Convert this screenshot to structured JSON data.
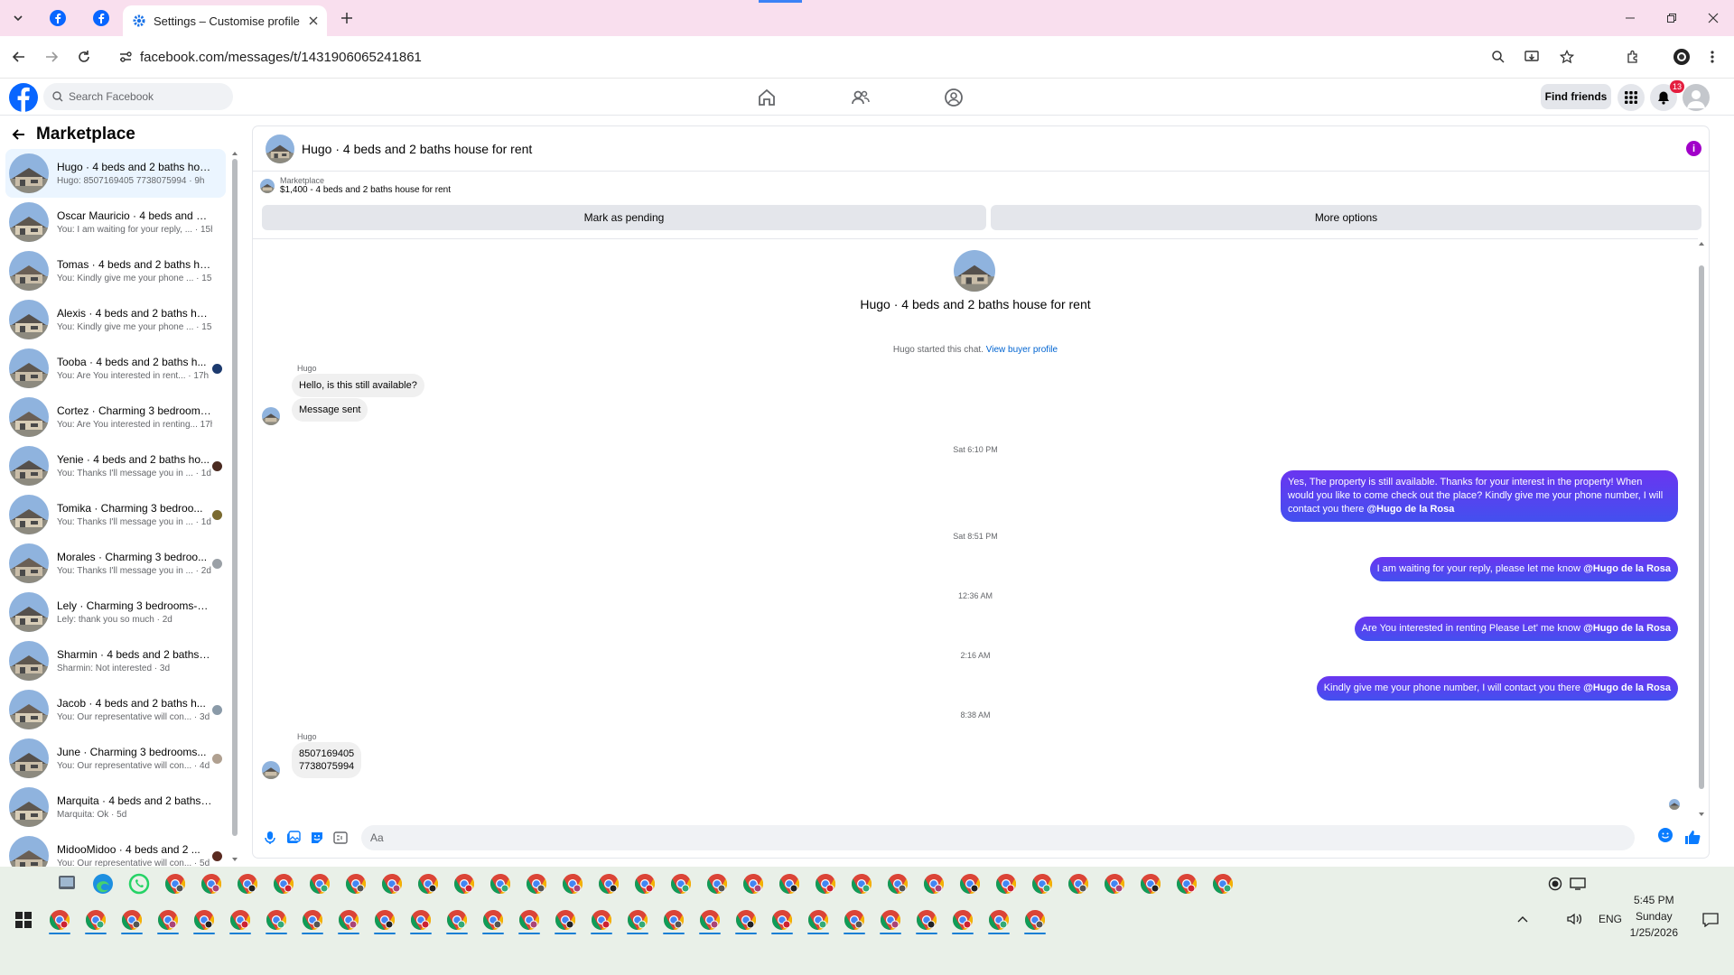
{
  "browser": {
    "tab_title": "Settings – Customise profile",
    "url": "facebook.com/messages/t/1431906065241861",
    "new_tab": "+"
  },
  "fb": {
    "search_placeholder": "Search Facebook",
    "find_friends": "Find friends",
    "notif_count": "13"
  },
  "sidebar": {
    "title": "Marketplace",
    "conversations": [
      {
        "name": "Hugo · 4 beds and 2 baths hous...",
        "preview": "Hugo: 8507169405 7738075994 · 9h"
      },
      {
        "name": "Oscar Mauricio · 4 beds and 2 b...",
        "preview": "You: I am waiting for your reply, ... · 15h"
      },
      {
        "name": "Tomas · 4 beds and 2 baths hou...",
        "preview": "You: Kindly give me your phone ... · 15h"
      },
      {
        "name": "Alexis · 4 beds and 2 baths hou...",
        "preview": "You: Kindly give me your phone ... · 15h"
      },
      {
        "name": "Tooba · 4 beds and 2 baths h...",
        "preview": "You: Are You interested in rent... · 17h"
      },
      {
        "name": "Cortez · Charming 3 bedrooms-...",
        "preview": "You: Are You interested in renting... 17h"
      },
      {
        "name": "Yenie · 4 beds and 2 baths ho...",
        "preview": "You: Thanks I'll message you in ... · 1d"
      },
      {
        "name": "Tomika · Charming 3 bedroo...",
        "preview": "You: Thanks I'll message you in ... · 1d"
      },
      {
        "name": "Morales · Charming 3 bedroo...",
        "preview": "You: Thanks I'll message you in ... · 2d"
      },
      {
        "name": "Lely · Charming 3 bedrooms-1 ...",
        "preview": "Lely: thank you so much · 2d"
      },
      {
        "name": "Sharmin · 4 beds and 2 baths h...",
        "preview": "Sharmin: Not interested · 3d"
      },
      {
        "name": "Jacob · 4 beds and 2 baths h...",
        "preview": "You: Our representative will con... · 3d"
      },
      {
        "name": "June · Charming 3 bedrooms...",
        "preview": "You: Our representative will con... · 4d"
      },
      {
        "name": "Marquita · 4 beds and 2 baths h...",
        "preview": "Marquita: Ok · 5d"
      },
      {
        "name": "MidooMidoo · 4 beds and 2 ...",
        "preview": "You: Our representative will con... · 5d"
      }
    ]
  },
  "chat": {
    "title": "Hugo · 4 beds and 2 baths house for rent",
    "listing_label": "Marketplace",
    "listing_price": "$1,400 - 4 beds and 2 baths house for rent",
    "mark_pending": "Mark as pending",
    "more_options": "More options",
    "intro_title": "Hugo · 4 beds and 2 baths house for rent",
    "started_text": "Hugo started this chat.",
    "view_buyer": "View buyer profile",
    "sender_name": "Hugo",
    "in_msg1": "Hello, is this still available?",
    "in_msg2": "Message sent",
    "ts1": "Sat 6:10 PM",
    "out_msg1": "Yes, The property is still available. Thanks for your interest in the property! When would you like to come check out the place? Kindly give me your phone number, I will contact you there",
    "mention": "@Hugo de la Rosa",
    "ts2": "Sat 8:51 PM",
    "out_msg2": "I am waiting for your reply, please let me know",
    "ts3": "12:36 AM",
    "out_msg3": "Are You  interested in renting Please Let' me know",
    "ts4": "2:16 AM",
    "out_msg4": "Kindly give me your phone number, I will contact you there",
    "ts5": "8:38 AM",
    "in_phone1": "8507169405",
    "in_phone2": "7738075994",
    "compose_placeholder": "Aa"
  },
  "taskbar": {
    "time": "5:45 PM",
    "day": "Sunday",
    "date": "1/25/2026",
    "lang": "ENG"
  },
  "colors": {
    "fb_blue": "#0866ff",
    "outgoing": "#5b36f2",
    "tab_bar": "#f9dfee"
  }
}
